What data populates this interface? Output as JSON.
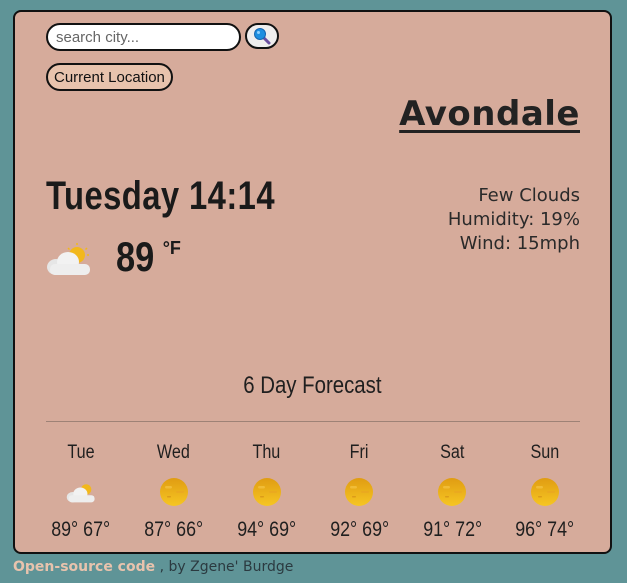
{
  "search": {
    "placeholder": "search city...",
    "button_icon": "search-icon"
  },
  "current_location_label": "Current Location",
  "city": "Avondale",
  "current": {
    "day_time": "Tuesday 14:14",
    "temp": "89",
    "unit": "°F",
    "icon": "few-clouds-icon",
    "condition": "Few Clouds",
    "humidity": "Humidity: 19%",
    "wind": "Wind: 15mph"
  },
  "forecast": {
    "title": "6 Day Forecast",
    "days": [
      {
        "name": "Tue",
        "icon": "few-clouds-icon",
        "temps": "89° 67°"
      },
      {
        "name": "Wed",
        "icon": "sun-icon",
        "temps": "87° 66°"
      },
      {
        "name": "Thu",
        "icon": "sun-icon",
        "temps": "94° 69°"
      },
      {
        "name": "Fri",
        "icon": "sun-icon",
        "temps": "92° 69°"
      },
      {
        "name": "Sat",
        "icon": "sun-icon",
        "temps": "91° 72°"
      },
      {
        "name": "Sun",
        "icon": "sun-icon",
        "temps": "96° 74°"
      }
    ]
  },
  "footer": {
    "link_text": "Open-source code",
    "by_text": " , by Zgene' Burdge"
  },
  "colors": {
    "background": "#5f9497",
    "card": "#d6ab9b",
    "button": "#e8c3ad",
    "sun": "#f2b81c"
  }
}
